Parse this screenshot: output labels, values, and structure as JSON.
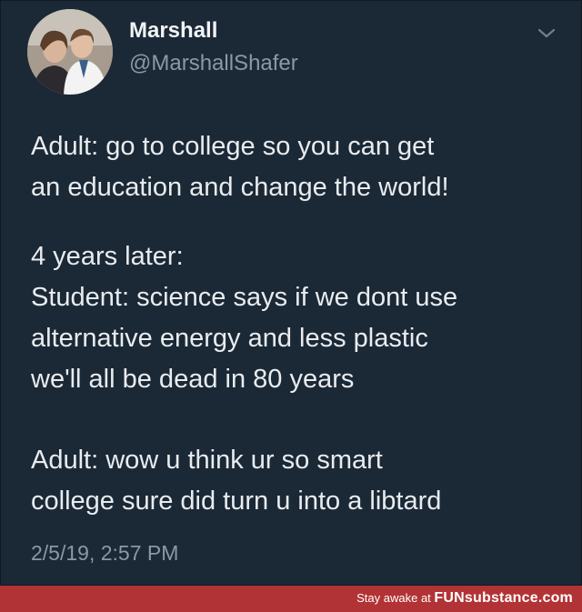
{
  "tweet": {
    "display_name": "Marshall",
    "handle": "@MarshallShafer",
    "paragraphs": [
      [
        "Adult: go to college so you can get",
        "an education and change the world!"
      ],
      [
        "4 years later:",
        "Student: science says if we dont use",
        "alternative energy and less plastic",
        "we'll all be dead in 80 years"
      ],
      [
        "Adult: wow u think ur so smart",
        "college sure did turn u into a libtard"
      ]
    ],
    "timestamp": "2/5/19, 2:57 PM",
    "menu_icon": "chevron-down-icon",
    "avatar_icon": "profile-photo"
  },
  "footer": {
    "prefix": "Stay awake at ",
    "brand": "FUNsubstance.com"
  },
  "colors": {
    "background": "#1b2836",
    "text": "#e8ecef",
    "secondary_text": "#8b98a5",
    "footer_bg": "#b23335"
  }
}
